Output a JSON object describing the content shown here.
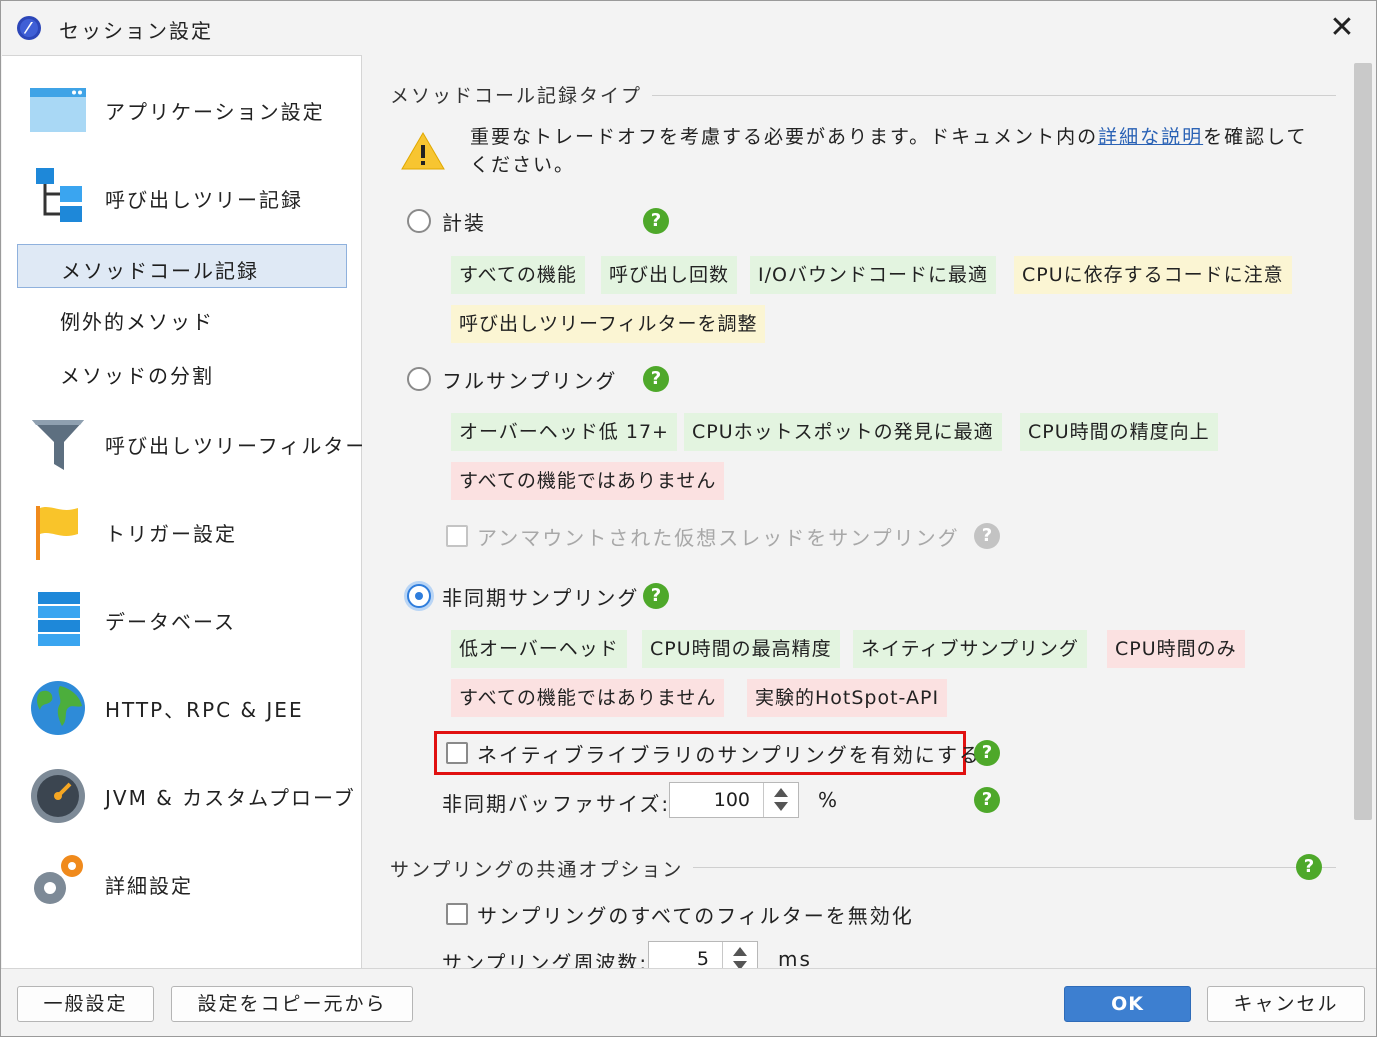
{
  "window": {
    "title": "セッション設定"
  },
  "sidebar": {
    "items": [
      {
        "label": "アプリケーション設定",
        "icon": "application-window-icon"
      },
      {
        "label": "呼び出しツリー記録",
        "icon": "call-tree-icon"
      },
      {
        "label": "メソッドコール記録",
        "sub": true,
        "active": true
      },
      {
        "label": "例外的メソッド",
        "sub": true
      },
      {
        "label": "メソッドの分割",
        "sub": true
      },
      {
        "label": "呼び出しツリーフィルター",
        "icon": "funnel-icon"
      },
      {
        "label": "トリガー設定",
        "icon": "flag-icon"
      },
      {
        "label": "データベース",
        "icon": "database-icon"
      },
      {
        "label": "HTTP、RPC & JEE",
        "icon": "globe-icon"
      },
      {
        "label": "JVM & カスタムプローブ",
        "icon": "gauge-icon"
      },
      {
        "label": "詳細設定",
        "icon": "gears-icon"
      }
    ]
  },
  "content": {
    "section1_title": "メソッドコール記録タイプ",
    "warning": {
      "text_before": "重要なトレードオフを考慮する必要があります。ドキュメント内の",
      "link": "詳細な説明",
      "text_after": "を確認してください。"
    },
    "instrumentation": {
      "label": "計装",
      "selected": false,
      "tags": [
        "すべての機能",
        "呼び出し回数",
        "I/Oバウンドコードに最適",
        "CPUに依存するコードに注意",
        "呼び出しツリーフィルターを調整"
      ]
    },
    "full_sampling": {
      "label": "フルサンプリング",
      "selected": false,
      "tags": [
        "オーバーヘッド低 17+",
        "CPUホットスポットの発見に最適",
        "CPU時間の精度向上",
        "すべての機能ではありません"
      ],
      "checkbox_label": "アンマウントされた仮想スレッドをサンプリング"
    },
    "async_sampling": {
      "label": "非同期サンプリング",
      "selected": true,
      "tags": [
        "低オーバーヘッド",
        "CPU時間の最高精度",
        "ネイティブサンプリング",
        "CPU時間のみ",
        "すべての機能ではありません",
        "実験的HotSpot-API"
      ],
      "native_checkbox_label": "ネイティブライブラリのサンプリングを有効にする",
      "buffer_label": "非同期バッファサイズ:",
      "buffer_value": "100",
      "buffer_unit": "%"
    },
    "section2_title": "サンプリングの共通オプション",
    "disable_filters_label": "サンプリングのすべてのフィルターを無効化",
    "frequency_label": "サンプリング周波数:",
    "frequency_value": "5",
    "frequency_unit": "ms"
  },
  "footer": {
    "general_settings": "一般設定",
    "copy_settings": "設定をコピー元から",
    "ok": "OK",
    "cancel": "キャンセル"
  },
  "help_glyph": "?"
}
